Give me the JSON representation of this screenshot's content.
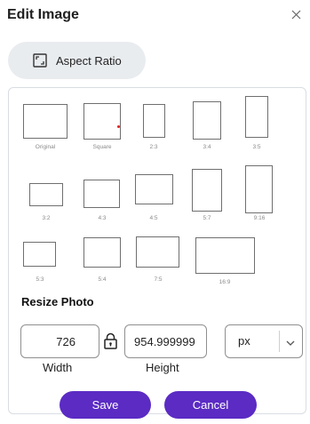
{
  "dialog": {
    "title": "Edit Image",
    "close_icon": "close-icon"
  },
  "aspect_button": {
    "label": "Aspect Ratio",
    "icon": "aspect-ratio-icon"
  },
  "ratios": [
    {
      "label": "Original"
    },
    {
      "label": "Square"
    },
    {
      "label": "2:3"
    },
    {
      "label": "3:4"
    },
    {
      "label": "3:5"
    },
    {
      "label": "3:2"
    },
    {
      "label": "4:3"
    },
    {
      "label": "4:5"
    },
    {
      "label": "5:7"
    },
    {
      "label": "9:16"
    },
    {
      "label": "5:3"
    },
    {
      "label": "5:4"
    },
    {
      "label": "7:5"
    },
    {
      "label": "16:9"
    }
  ],
  "resize": {
    "title": "Resize Photo",
    "width_value": "726",
    "height_value": "954.999999",
    "width_caption": "Width",
    "height_caption": "Height",
    "unit_value": "px",
    "lock_icon": "lock-icon"
  },
  "buttons": {
    "save": "Save",
    "cancel": "Cancel"
  },
  "colors": {
    "primary": "#5b2bc4",
    "pill_bg": "#e9ecef",
    "box_border": "#6f6f6f"
  }
}
